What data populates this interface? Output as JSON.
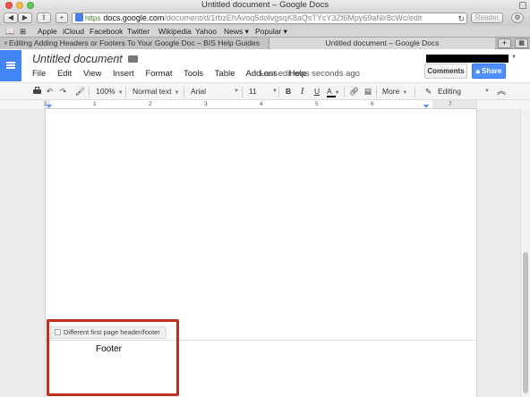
{
  "window": {
    "title": "Untitled document – Google Docs"
  },
  "browser": {
    "url_scheme": "https",
    "url_host": "docs.google.com",
    "url_path": "/document/d/1rbzEhAvoq5doIvgsqK8aQsTYcY3Zf6Mpy69aNlr8cWc/edit",
    "reader_label": "Reader",
    "bookmarks": [
      "Apple",
      "iCloud",
      "Facebook",
      "Twitter",
      "Wikipedia",
      "Yahoo",
      "News ▾",
      "Popular ▾"
    ],
    "tabs": [
      {
        "label": "Editing Adding Headers or Footers To Your Google Doc – BIS Help Guides"
      },
      {
        "label": "Untitled document – Google Docs"
      }
    ]
  },
  "docs": {
    "title": "Untitled document",
    "menu": [
      "File",
      "Edit",
      "View",
      "Insert",
      "Format",
      "Tools",
      "Table",
      "Add-ons",
      "Help"
    ],
    "last_edit": "Last edit was seconds ago",
    "comments_label": "Comments",
    "share_label": "Share",
    "accent_color": "#4285f4"
  },
  "toolbar": {
    "zoom": "100%",
    "style": "Normal text",
    "font": "Arial",
    "size": "11",
    "bold": "B",
    "italic": "I",
    "underline": "U",
    "text_color": "A",
    "more": "More",
    "mode": "Editing"
  },
  "ruler": {
    "numbers": [
      "1",
      "1",
      "2",
      "3",
      "4",
      "5",
      "6",
      "7"
    ]
  },
  "footer": {
    "option_label": "Different first page header/footer",
    "text": "Footer"
  },
  "highlight": {
    "color": "#c0301e"
  }
}
